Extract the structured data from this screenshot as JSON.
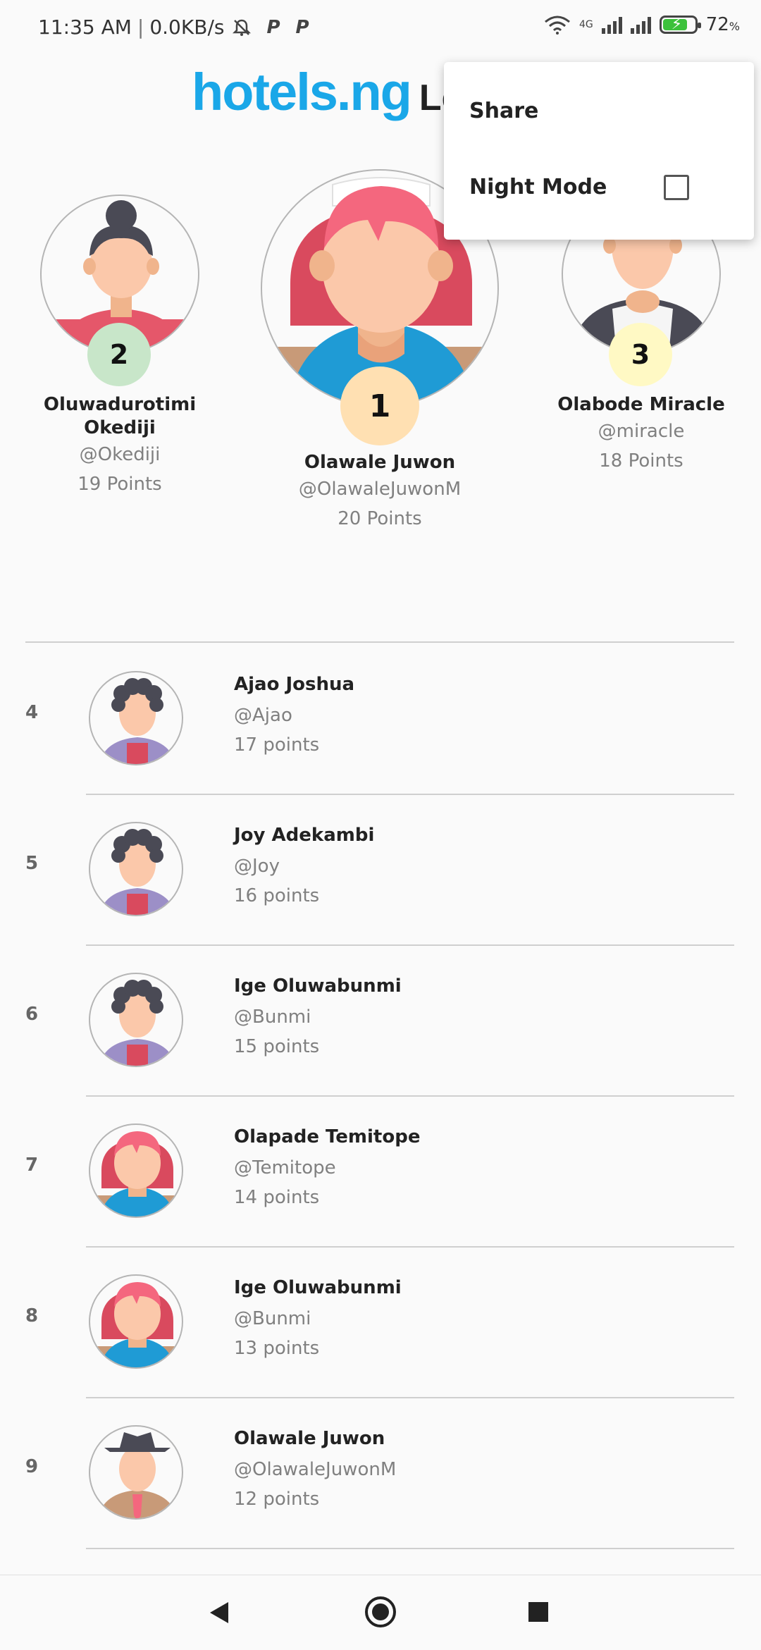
{
  "status_bar": {
    "time": "11:35 AM",
    "speed": "0.0KB/s",
    "network_type": "4G",
    "battery": "72"
  },
  "header": {
    "brand": "hotels.ng",
    "title_visible": "Leade"
  },
  "podium": [
    {
      "rank": "2",
      "name_line1": "Oluwadurotimi",
      "name_line2": "Okediji",
      "handle": "@Okediji",
      "points": "19 Points",
      "badge_color": "#c8e6c9"
    },
    {
      "rank": "1",
      "name_line1": "Olawale Juwon",
      "name_line2": "",
      "handle": "@OlawaleJuwonM",
      "points": "20 Points",
      "badge_color": "#ffe0b2"
    },
    {
      "rank": "3",
      "name_line1": "Olabode Miracle",
      "name_line2": "",
      "handle": "@miracle",
      "points": "18 Points",
      "badge_color": "#fff9c4"
    }
  ],
  "list": [
    {
      "rank": "4",
      "name": "Ajao Joshua",
      "handle": "@Ajao",
      "points": "17 points",
      "avatar": "curly-hair-avatar"
    },
    {
      "rank": "5",
      "name": "Joy Adekambi",
      "handle": "@Joy",
      "points": "16 points",
      "avatar": "curly-hair-avatar"
    },
    {
      "rank": "6",
      "name": "Ige Oluwabunmi",
      "handle": "@Bunmi",
      "points": "15 points",
      "avatar": "curly-hair-avatar"
    },
    {
      "rank": "7",
      "name": "Olapade Temitope",
      "handle": "@Temitope",
      "points": "14 points",
      "avatar": "pink-hair-avatar"
    },
    {
      "rank": "8",
      "name": "Ige Oluwabunmi",
      "handle": "@Bunmi",
      "points": "13 points",
      "avatar": "pink-hair-avatar"
    },
    {
      "rank": "9",
      "name": "Olawale Juwon",
      "handle": "@OlawaleJuwonM",
      "points": "12 points",
      "avatar": "cowboy-avatar"
    }
  ],
  "menu": {
    "share": "Share",
    "night_mode": "Night Mode",
    "night_mode_checked": false
  },
  "colors": {
    "brand_blue": "#1aa7e8",
    "background": "#fafafa"
  }
}
